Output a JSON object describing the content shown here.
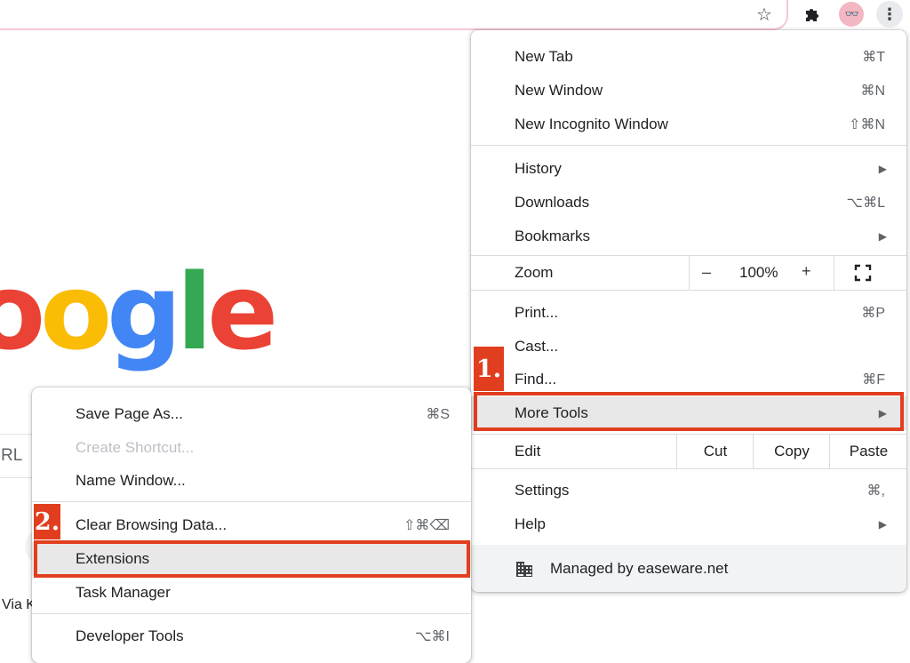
{
  "toolbar": {
    "bookmark_icon": "star-icon",
    "extensions_icon": "puzzle-icon",
    "profile_glyph": "👓",
    "menu_icon": "kebab-icon"
  },
  "page": {
    "logo_visible": "ogle",
    "search_fragment": "RL",
    "footer_fragment": "Via K"
  },
  "menu": {
    "items": [
      {
        "label": "New Tab",
        "shortcut": "⌘T"
      },
      {
        "label": "New Window",
        "shortcut": "⌘N"
      },
      {
        "label": "New Incognito Window",
        "shortcut": "⇧⌘N"
      },
      {
        "label": "History",
        "shortcut": "▶"
      },
      {
        "label": "Downloads",
        "shortcut": "⌥⌘L"
      },
      {
        "label": "Bookmarks",
        "shortcut": "▶"
      },
      {
        "label": "Print...",
        "shortcut": "⌘P"
      },
      {
        "label": "Cast...",
        "shortcut": ""
      },
      {
        "label": "Find...",
        "shortcut": "⌘F"
      },
      {
        "label": "More Tools",
        "shortcut": "▶"
      },
      {
        "label": "Settings",
        "shortcut": "⌘,"
      },
      {
        "label": "Help",
        "shortcut": "▶"
      }
    ],
    "zoom": {
      "label": "Zoom",
      "minus": "–",
      "value": "100%",
      "plus": "+"
    },
    "edit": {
      "label": "Edit",
      "cut": "Cut",
      "copy": "Copy",
      "paste": "Paste"
    },
    "managed": {
      "label": "Managed by easeware.net"
    }
  },
  "submenu": {
    "items": [
      {
        "label": "Save Page As...",
        "shortcut": "⌘S",
        "enabled": true
      },
      {
        "label": "Create Shortcut...",
        "shortcut": "",
        "enabled": false
      },
      {
        "label": "Name Window...",
        "shortcut": "",
        "enabled": true
      },
      {
        "label": "Clear Browsing Data...",
        "shortcut": "⇧⌘⌫",
        "enabled": true
      },
      {
        "label": "Extensions",
        "shortcut": "",
        "enabled": true
      },
      {
        "label": "Task Manager",
        "shortcut": "",
        "enabled": true
      },
      {
        "label": "Developer Tools",
        "shortcut": "⌥⌘I",
        "enabled": true
      }
    ]
  },
  "annotations": {
    "step1": "1.",
    "step2": "2.",
    "highlight_color": "#e03e1f"
  }
}
